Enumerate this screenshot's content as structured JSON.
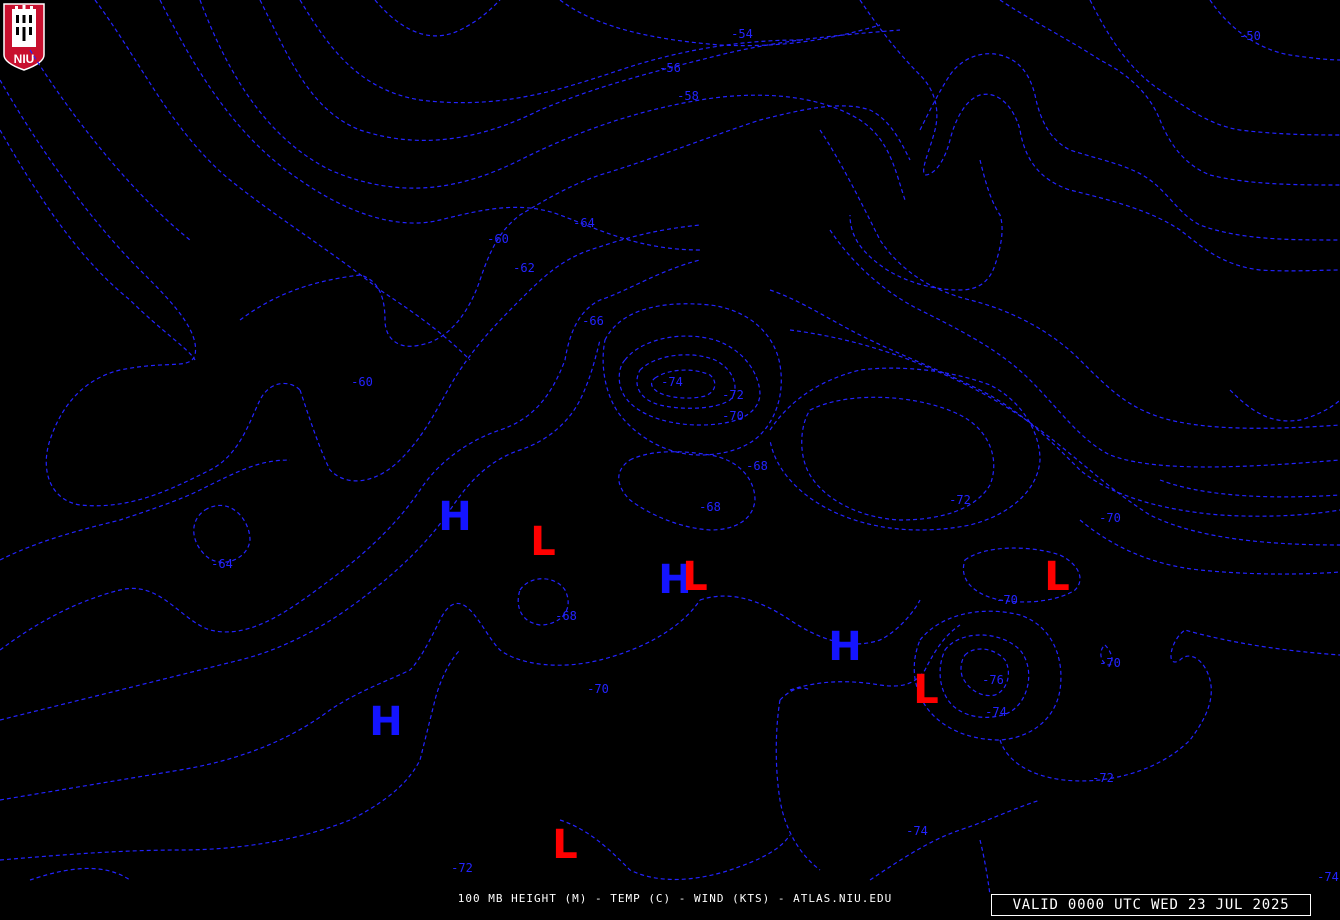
{
  "logo": {
    "text": "NIU",
    "colors": {
      "shield": "#c8102e",
      "tower": "#ffffff"
    }
  },
  "caption": "100 MB HEIGHT (M) - TEMP (C) - WIND (KTS) - ATLAS.NIU.EDU",
  "valid_time": "VALID 0000 UTC WED 23 JUL 2025",
  "colors": {
    "background": "#000000",
    "contour": "#2323ff",
    "high": "#1414ff",
    "low": "#ff0000",
    "text": "#ffffff"
  },
  "contour_labels": [
    "-54",
    "-50",
    "-56",
    "-58",
    "-60",
    "-64",
    "-62",
    "-66",
    "-60",
    "-74",
    "-72",
    "-70",
    "-68",
    "-68",
    "-72",
    "-70",
    "-64",
    "-68",
    "-70",
    "-70",
    "-70",
    "-76",
    "-74",
    "-72",
    "-74",
    "-72",
    "-74"
  ],
  "pressure_centers": [
    {
      "type": "H",
      "label": "H"
    },
    {
      "type": "L",
      "label": "L"
    },
    {
      "type": "H",
      "label": "H"
    },
    {
      "type": "L",
      "label": "L"
    },
    {
      "type": "H",
      "label": "H"
    },
    {
      "type": "L",
      "label": "L"
    },
    {
      "type": "L",
      "label": "L"
    },
    {
      "type": "H",
      "label": "H"
    },
    {
      "type": "L",
      "label": "L"
    }
  ]
}
